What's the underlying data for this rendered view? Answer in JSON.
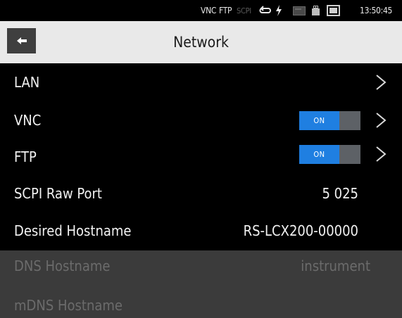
{
  "status_bar": {
    "vnc": "VNC",
    "ftp": "FTP",
    "scpi": "SCPI",
    "time": "13:50:45",
    "icons": [
      "refresh-icon",
      "power-plug-icon",
      "card-icon",
      "usb-drive-icon",
      "screenshot-icon"
    ]
  },
  "header": {
    "title": "Network",
    "back_icon": "arrow-left-icon"
  },
  "rows": {
    "lan": {
      "label": "LAN"
    },
    "vnc": {
      "label": "VNC",
      "toggle": "ON"
    },
    "ftp": {
      "label": "FTP",
      "toggle": "ON"
    },
    "scpi_raw_port": {
      "label": "SCPI Raw Port",
      "value": "5 025"
    },
    "desired_hostname": {
      "label": "Desired Hostname",
      "value": "RS-LCX200-00000"
    },
    "dns_hostname": {
      "label": "DNS Hostname",
      "value": "instrument"
    },
    "mdns_hostname": {
      "label": "mDNS Hostname"
    }
  },
  "colors": {
    "toggle_on": "#1f7fe1",
    "title_bar": "#e9e9e9",
    "disabled_row": "#3b3b3b"
  }
}
